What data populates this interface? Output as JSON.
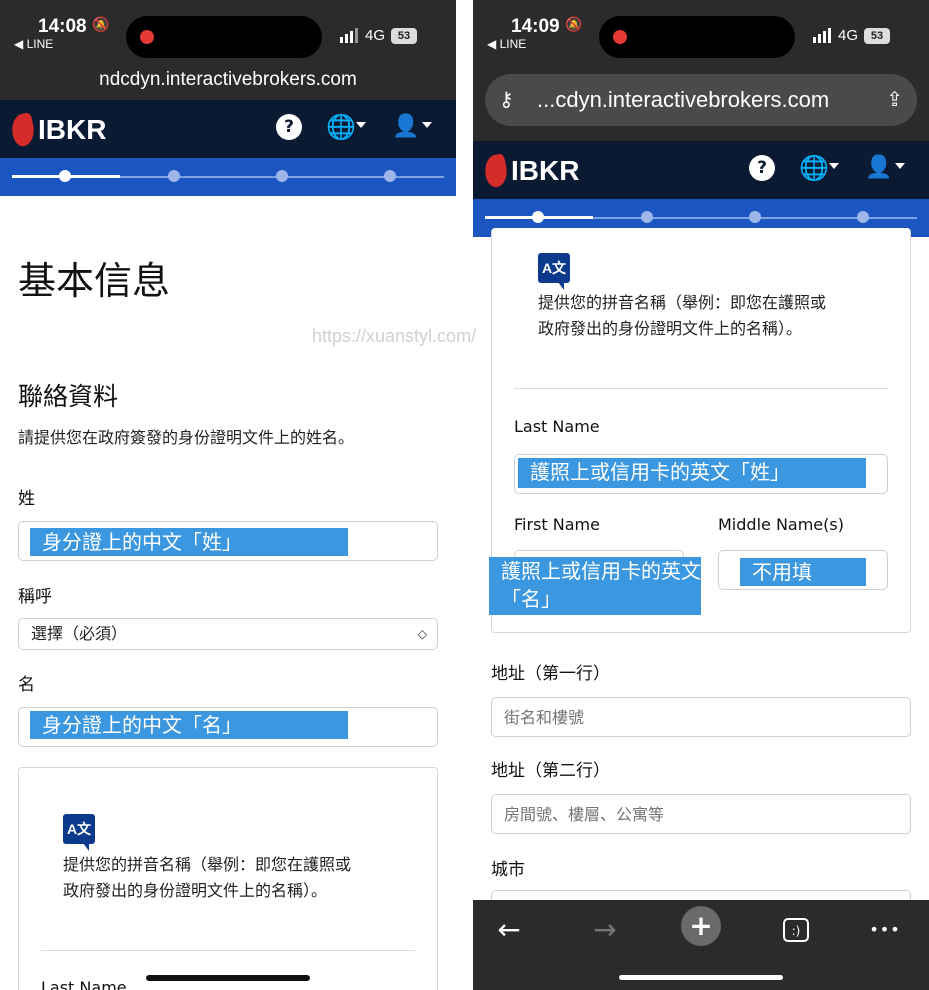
{
  "left": {
    "status": {
      "time": "14:08",
      "back_app": "◀ LINE",
      "network": "4G",
      "battery": "53"
    },
    "url": "ndcdyn.interactivebrokers.com",
    "brand": "IBKR",
    "page_title": "基本信息",
    "section_title": "聯絡資料",
    "section_desc": "請提供您在政府簽發的身份證明文件上的姓名。",
    "last_name_label": "姓",
    "last_name_note": "身分證上的中文「姓」",
    "salutation_label": "稱呼",
    "salutation_value": "選擇（必須）",
    "first_name_label": "名",
    "first_name_note": "身分證上的中文「名」",
    "translit_icon": "A文",
    "translit_text": "提供您的拼音名稱（舉例：即您在護照或政府發出的身份證明文件上的名稱）。",
    "card_last_name": "Last Name"
  },
  "right": {
    "status": {
      "time": "14:09",
      "back_app": "◀ LINE",
      "network": "4G",
      "battery": "53"
    },
    "url": "...cdyn.interactivebrokers.com",
    "brand": "IBKR",
    "translit_icon": "A文",
    "translit_text": "提供您的拼音名稱（舉例：即您在護照或政府發出的身份證明文件上的名稱）。",
    "last_name_label": "Last Name",
    "last_name_note": "護照上或信用卡的英文「姓」",
    "first_name_label": "First Name",
    "first_name_note": "護照上或信用卡的英文「名」",
    "middle_name_label": "Middle Name(s)",
    "middle_name_note": "不用填",
    "address1_label": "地址（第一行）",
    "address1_placeholder": "街名和樓號",
    "address2_label": "地址（第二行）",
    "address2_placeholder": "房間號、樓層、公寓等",
    "city_label": "城市",
    "toolbar": {
      "back": "←",
      "forward": "→",
      "new_tab": "+",
      "tabs": ":)",
      "more": "•••"
    }
  },
  "watermark": "https://xuanstyl.com/"
}
